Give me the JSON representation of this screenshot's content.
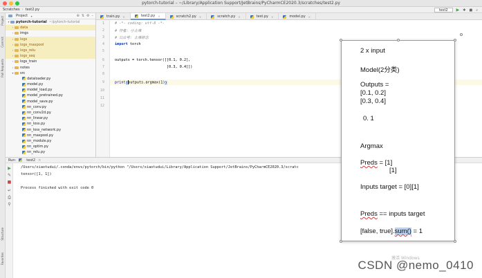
{
  "window": {
    "title": "pytorch-tutorial – ~/Library/Application Support/JetBrains/PyCharmCE2020.3/scratches/test2.py"
  },
  "navbar": {
    "breadcrumb": [
      "Scratches",
      "test2.py"
    ],
    "run_config": "test2"
  },
  "tool_windows": {
    "left": [
      "Project",
      "Commit",
      "Pull Requests",
      "Structure",
      "Favorites"
    ]
  },
  "project": {
    "header": "Project",
    "root": "pytorch-tutorial",
    "root_path": "~/pytorch-tutorial",
    "folders": [
      "data",
      "imgs",
      "logs",
      "logs_maxpool",
      "logs_relu",
      "logs_seq",
      "logs_train",
      "notes",
      "src"
    ],
    "files": [
      "dataloader.py",
      "model.py",
      "model_load.py",
      "model_pretrained.py",
      "model_save.py",
      "nn_conv.py",
      "nn_conv2d.py",
      "nn_linear.py",
      "nn_loss.py",
      "nn_loss_network.py",
      "nn_maxpool.py",
      "nn_module.py",
      "nn_optim.py",
      "nn_relu.py"
    ]
  },
  "tabs": [
    "train.py",
    "test2.py",
    "scratch2.py",
    "scratch.py",
    "test.py",
    "model.py"
  ],
  "editor": {
    "lines": [
      {
        "n": "1",
        "text": "# -*- coding: utf-8 -*-"
      },
      {
        "n": "2",
        "text": "# 作者: 小土堆"
      },
      {
        "n": "3",
        "text": "# 公众号: 土堆碎念"
      },
      {
        "n": "4",
        "kw": "import",
        "rest": " torch"
      },
      {
        "n": "5",
        "text": ""
      },
      {
        "n": "6",
        "text": "outputs = torch.tensor([[0.1, 0.2],"
      },
      {
        "n": "7",
        "text": "                        [0.3, 0.4]])"
      },
      {
        "n": "8",
        "text": ""
      },
      {
        "n": "9",
        "fn": "print",
        "open": "(",
        "mid": "outputs.argmax(1)",
        "close": ")"
      },
      {
        "n": "10",
        "text": ""
      },
      {
        "n": "11",
        "text": ""
      },
      {
        "n": "12",
        "text": ""
      }
    ]
  },
  "run": {
    "label": "Run:",
    "config": "test2",
    "command": "/Users/xiaotudui/.conda/envs/pytorch/bin/python \"/Users/xiaotudui/Library/Application Support/JetBrains/PyCharmCE2020.3/scratc",
    "output": "tensor([1, 1])",
    "exit": "Process finished with exit code 0"
  },
  "slide": {
    "line1": "2 x input",
    "line2": "Model(2分类)",
    "line3": "Outputs =",
    "line4": "[0.1, 0.2]",
    "line5": "[0.3, 0.4]",
    "line6": "0.    1",
    "line7": "Argmax",
    "line8_word": "Preds",
    "line8_rest": " = [1]",
    "line9": "[1]",
    "line10": "Inputs target = [0][1]",
    "line11_word": "Preds",
    "line11_rest": " == inputs target",
    "line12_pre": "[false, true].",
    "line12_sel": "sum()",
    "line12_post": " = 1"
  },
  "watermarks": {
    "csdn": "CSDN @nemo_0410",
    "windows": "激活 Windows"
  }
}
